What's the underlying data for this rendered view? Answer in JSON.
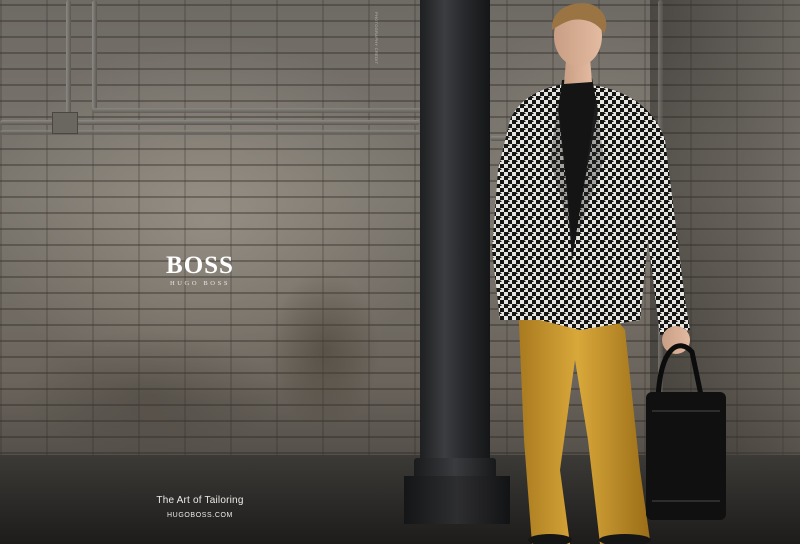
{
  "brand": {
    "logo_wordmark": "BOSS",
    "logo_subline": "HUGO BOSS"
  },
  "campaign": {
    "tagline": "The Art of Tailoring",
    "website": "HUGOBOSS.COM"
  },
  "photo_credit": "PHOTOGRAPHY CREDIT",
  "colors": {
    "wall": "#7b766e",
    "column": "#2a2b2e",
    "trousers": "#c9992e",
    "jacket_check": "#1a1a1a",
    "text": "#ffffff"
  }
}
